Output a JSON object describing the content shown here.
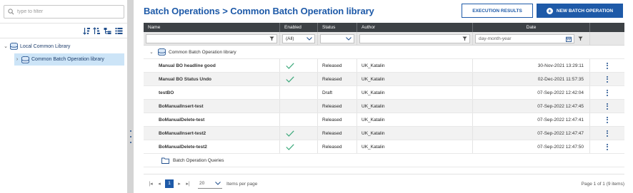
{
  "tree": {
    "filter_placeholder": "type to filter",
    "tools": [
      "sort-asc-icon",
      "sort-desc-icon",
      "tree-view-icon",
      "list-view-icon"
    ],
    "root_label": "Local Common Library",
    "child_label": "Common Batch Operation library"
  },
  "header": {
    "title": "Batch Operations > Common Batch Operation library",
    "execution_results": "EXECUTION RESULTS",
    "new_batch_operation": "NEW BATCH OPERATION"
  },
  "grid": {
    "columns": {
      "name": "Name",
      "enabled": "Enabled",
      "status": "Status",
      "author": "Author",
      "date": "Date"
    },
    "filters": {
      "enabled": "(All)",
      "date_placeholder": "day-month-year"
    },
    "group_label": "Common Batch Operation library",
    "rows": [
      {
        "name": "Manual BO headline good",
        "enabled": true,
        "status": "Released",
        "author": "UK_Katalin",
        "date": "30-Nov-2021 13:29:11"
      },
      {
        "name": "Manual BO Status Undo",
        "enabled": true,
        "status": "Released",
        "author": "UK_Katalin",
        "date": "02-Dec-2021 11:57:35"
      },
      {
        "name": "testBO",
        "enabled": false,
        "status": "Draft",
        "author": "UK_Katalin",
        "date": "07-Sep-2022 12:42:04"
      },
      {
        "name": "BoManualInsert-test",
        "enabled": false,
        "status": "Released",
        "author": "UK_Katalin",
        "date": "07-Sep-2022 12:47:45"
      },
      {
        "name": "BoManualDelete-test",
        "enabled": false,
        "status": "Released",
        "author": "UK_Katalin",
        "date": "07-Sep-2022 12:47:41"
      },
      {
        "name": "BoManualInsert-test2",
        "enabled": true,
        "status": "Released",
        "author": "UK_Katalin",
        "date": "07-Sep-2022 12:47:47"
      },
      {
        "name": "BoManualDelete-test2",
        "enabled": true,
        "status": "Released",
        "author": "UK_Katalin",
        "date": "07-Sep-2022 12:47:50"
      }
    ],
    "queries_label": "Batch Operation Queries"
  },
  "pager": {
    "current_page": "1",
    "page_size": "20",
    "items_per_page": "Items per page",
    "info": "Page 1 of 1 (9 items)"
  },
  "colors": {
    "brand": "#1e5aa8",
    "header_bg": "#3d4145",
    "check": "#3aa87a",
    "selection": "#cce4f7"
  }
}
